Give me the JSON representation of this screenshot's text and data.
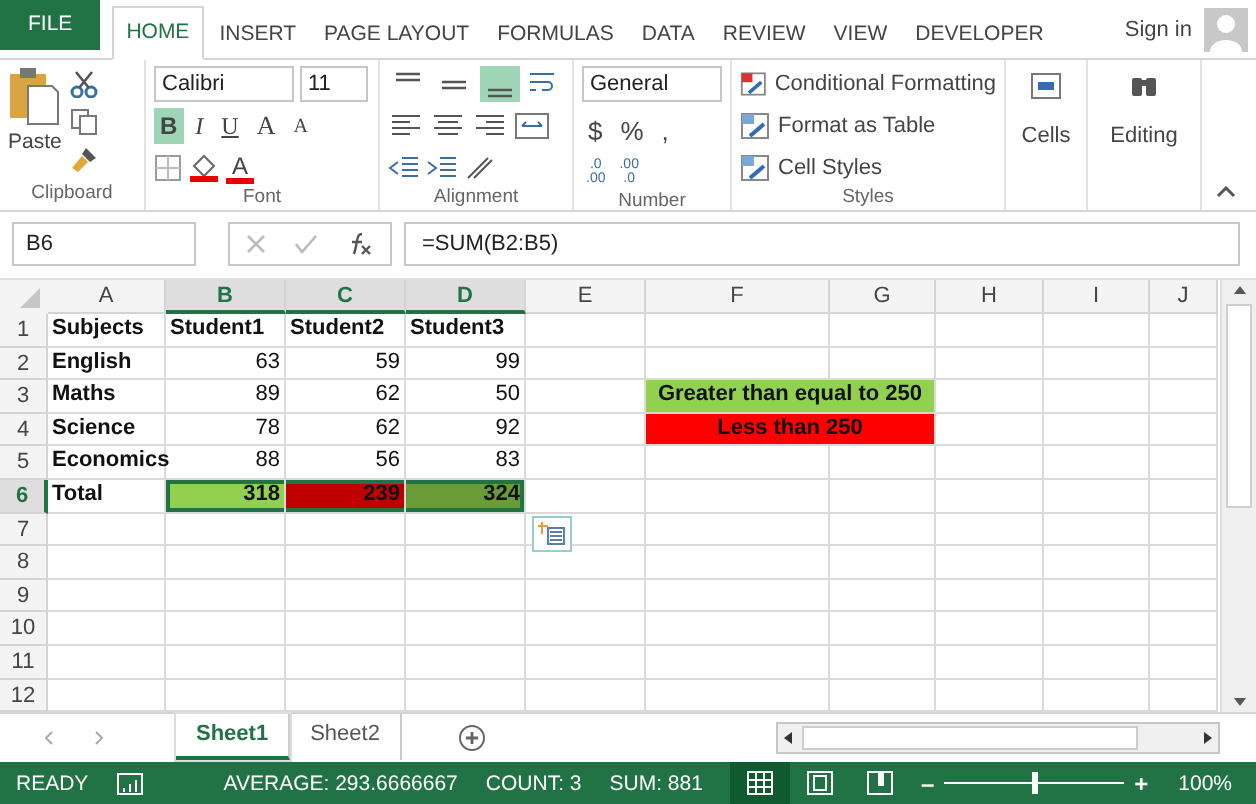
{
  "tabs": [
    {
      "label": "FILE",
      "kind": "file",
      "selected": false
    },
    {
      "label": "HOME",
      "kind": "tab",
      "selected": true
    },
    {
      "label": "INSERT",
      "kind": "tab",
      "selected": false
    },
    {
      "label": "PAGE LAYOUT",
      "kind": "tab",
      "selected": false
    },
    {
      "label": "FORMULAS",
      "kind": "tab",
      "selected": false
    },
    {
      "label": "DATA",
      "kind": "tab",
      "selected": false
    },
    {
      "label": "REVIEW",
      "kind": "tab",
      "selected": false
    },
    {
      "label": "VIEW",
      "kind": "tab",
      "selected": false
    },
    {
      "label": "DEVELOPER",
      "kind": "tab",
      "selected": false
    }
  ],
  "sign_in": "Sign in",
  "ribbon": {
    "clipboard": {
      "label": "Clipboard",
      "paste": "Paste"
    },
    "font": {
      "label": "Font",
      "name": "Calibri",
      "size": "11",
      "styles": [
        {
          "text": "B",
          "selected": true
        },
        {
          "text": "I",
          "selected": false
        },
        {
          "text": "U",
          "selected": false
        }
      ],
      "grow": "A",
      "shrink": "A",
      "color_letter": "A"
    },
    "alignment": {
      "label": "Alignment",
      "vertical": [
        {
          "selected": false
        },
        {
          "selected": false
        },
        {
          "selected": true
        }
      ]
    },
    "number": {
      "label": "Number",
      "format": "General",
      "currency": "$",
      "percent": "%",
      "comma": ",",
      "decimals": [
        ".0",
        ".00",
        ".00",
        ".0"
      ]
    },
    "styles": {
      "label": "Styles",
      "items": [
        "Conditional Formatting",
        "Format as Table",
        "Cell Styles"
      ]
    },
    "cells": {
      "label": "Cells"
    },
    "editing": {
      "label": "Editing"
    }
  },
  "name_box": "B6",
  "formula": "=SUM(B2:B5)",
  "columns": [
    {
      "label": "A",
      "selected": false
    },
    {
      "label": "B",
      "selected": true
    },
    {
      "label": "C",
      "selected": true
    },
    {
      "label": "D",
      "selected": true
    },
    {
      "label": "E",
      "selected": false
    },
    {
      "label": "F",
      "selected": false
    },
    {
      "label": "G",
      "selected": false
    },
    {
      "label": "H",
      "selected": false
    },
    {
      "label": "I",
      "selected": false
    },
    {
      "label": "J",
      "selected": false
    }
  ],
  "rows": [
    {
      "number": "1",
      "selected": false,
      "cells": [
        {
          "text": "Subjects",
          "kind": "text",
          "bold": true,
          "selected": false
        },
        {
          "text": "Student1",
          "kind": "text",
          "bold": true,
          "selected": false
        },
        {
          "text": "Student2",
          "kind": "text",
          "bold": true,
          "selected": false
        },
        {
          "text": "Student3",
          "kind": "text",
          "bold": true,
          "selected": false
        }
      ]
    },
    {
      "number": "2",
      "selected": false,
      "cells": [
        {
          "text": "English",
          "kind": "text",
          "bold": true,
          "selected": false
        },
        {
          "text": "63",
          "kind": "number",
          "bold": false,
          "selected": false
        },
        {
          "text": "59",
          "kind": "number",
          "bold": false,
          "selected": false
        },
        {
          "text": "99",
          "kind": "number",
          "bold": false,
          "selected": false
        }
      ]
    },
    {
      "number": "3",
      "selected": false,
      "cells": [
        {
          "text": "Maths",
          "kind": "text",
          "bold": true,
          "selected": false
        },
        {
          "text": "89",
          "kind": "number",
          "bold": false,
          "selected": false
        },
        {
          "text": "62",
          "kind": "number",
          "bold": false,
          "selected": false
        },
        {
          "text": "50",
          "kind": "number",
          "bold": false,
          "selected": false
        }
      ],
      "note": {
        "text": "Greater than equal to 250",
        "color": "#92d050"
      }
    },
    {
      "number": "4",
      "selected": false,
      "cells": [
        {
          "text": "Science",
          "kind": "text",
          "bold": true,
          "selected": false
        },
        {
          "text": "78",
          "kind": "number",
          "bold": false,
          "selected": false
        },
        {
          "text": "62",
          "kind": "number",
          "bold": false,
          "selected": false
        },
        {
          "text": "92",
          "kind": "number",
          "bold": false,
          "selected": false
        }
      ],
      "note": {
        "text": "Less than 250",
        "color": "#ff0000"
      }
    },
    {
      "number": "5",
      "selected": false,
      "cells": [
        {
          "text": "Economics",
          "kind": "text",
          "bold": true,
          "selected": false
        },
        {
          "text": "88",
          "kind": "number",
          "bold": false,
          "selected": false
        },
        {
          "text": "56",
          "kind": "number",
          "bold": false,
          "selected": false
        },
        {
          "text": "83",
          "kind": "number",
          "bold": false,
          "selected": false
        }
      ]
    },
    {
      "number": "6",
      "selected": true,
      "cells": [
        {
          "text": "Total",
          "kind": "text",
          "bold": true,
          "selected": false
        },
        {
          "text": "318",
          "kind": "number",
          "bold": true,
          "selected": true,
          "color": "#92d050"
        },
        {
          "text": "239",
          "kind": "number",
          "bold": true,
          "selected": true,
          "color": "#c00000"
        },
        {
          "text": "324",
          "kind": "number",
          "bold": true,
          "selected": true,
          "color": "#6b9b37"
        }
      ]
    },
    {
      "number": "7",
      "selected": false
    },
    {
      "number": "8",
      "selected": false
    },
    {
      "number": "9",
      "selected": false
    },
    {
      "number": "10",
      "selected": false
    },
    {
      "number": "11",
      "selected": false
    },
    {
      "number": "12",
      "selected": false
    }
  ],
  "sheets": [
    {
      "label": "Sheet1",
      "selected": true
    },
    {
      "label": "Sheet2",
      "selected": false
    }
  ],
  "status": {
    "mode": "READY",
    "stats": [
      "AVERAGE: 293.6666667",
      "COUNT: 3",
      "SUM: 881"
    ],
    "zoom_out": "–",
    "zoom_in": "+",
    "zoom": "100%",
    "zoom_level": {
      "level": 0.5
    }
  }
}
